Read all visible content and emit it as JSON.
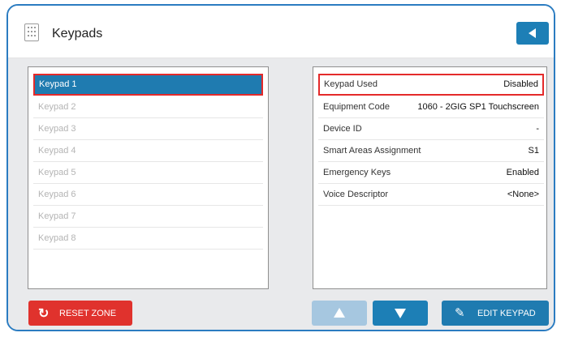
{
  "header": {
    "title": "Keypads",
    "icon": "keypad-icon",
    "back_icon": "back-arrow-icon"
  },
  "keypad_list": [
    {
      "label": "Keypad 1",
      "selected": true
    },
    {
      "label": "Keypad 2",
      "selected": false
    },
    {
      "label": "Keypad 3",
      "selected": false
    },
    {
      "label": "Keypad 4",
      "selected": false
    },
    {
      "label": "Keypad 5",
      "selected": false
    },
    {
      "label": "Keypad 6",
      "selected": false
    },
    {
      "label": "Keypad 7",
      "selected": false
    },
    {
      "label": "Keypad 8",
      "selected": false
    }
  ],
  "properties": [
    {
      "label": "Keypad Used",
      "value": "Disabled",
      "highlighted": true
    },
    {
      "label": "Equipment Code",
      "value": "1060 - 2GIG SP1 Touchscreen"
    },
    {
      "label": "Device ID",
      "value": "-"
    },
    {
      "label": "Smart Areas Assignment",
      "value": "S1"
    },
    {
      "label": "Emergency Keys",
      "value": "Enabled"
    },
    {
      "label": "Voice Descriptor",
      "value": "<None>"
    }
  ],
  "buttons": {
    "reset_label": "RESET ZONE",
    "edit_label": "EDIT KEYPAD"
  },
  "colors": {
    "accent": "#1d7fb6",
    "danger": "#e0322d",
    "highlight_border": "#e42a2a",
    "disabled_button": "#a6c7e0"
  }
}
